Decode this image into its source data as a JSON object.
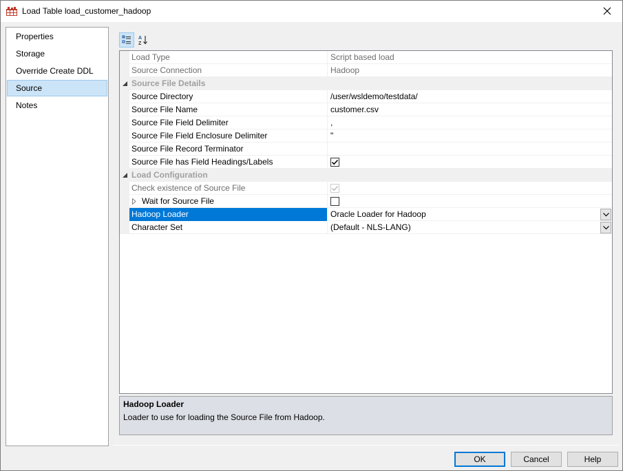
{
  "window": {
    "title": "Load Table load_customer_hadoop",
    "app_icon": "table-icon",
    "close_icon": "close-icon"
  },
  "nav": {
    "items": [
      {
        "label": "Properties",
        "selected": false
      },
      {
        "label": "Storage",
        "selected": false
      },
      {
        "label": "Override Create DDL",
        "selected": false
      },
      {
        "label": "Source",
        "selected": true
      },
      {
        "label": "Notes",
        "selected": false
      }
    ]
  },
  "toolbar": {
    "categorized_icon": "categorized-view-icon",
    "alphabetical_icon": "sort-alphabetical-icon"
  },
  "grid": {
    "rows": [
      {
        "name": "Load Type",
        "value": "Script based load"
      },
      {
        "name": "Source Connection",
        "value": "Hadoop"
      },
      {
        "name": "Source File Details"
      },
      {
        "name": "Source Directory",
        "value": "/user/wsldemo/testdata/"
      },
      {
        "name": "Source File Name",
        "value": "customer.csv"
      },
      {
        "name": "Source File Field Delimiter",
        "value": ","
      },
      {
        "name": "Source File Field Enclosure Delimiter",
        "value": "\""
      },
      {
        "name": "Source File Record Terminator",
        "value": ""
      },
      {
        "name": "Source File has Field Headings/Labels",
        "checked": true
      },
      {
        "name": "Load Configuration"
      },
      {
        "name": "Check existence of Source File",
        "checked": true
      },
      {
        "name": "Wait for Source File",
        "checked": false
      },
      {
        "name": "Hadoop Loader",
        "value": "Oracle Loader for Hadoop"
      },
      {
        "name": "Character Set",
        "value": "(Default - NLS-LANG)"
      }
    ]
  },
  "description": {
    "title": "Hadoop Loader",
    "text": "Loader to use for loading the Source File from Hadoop."
  },
  "buttons": {
    "ok": "OK",
    "cancel": "Cancel",
    "help": "Help"
  }
}
